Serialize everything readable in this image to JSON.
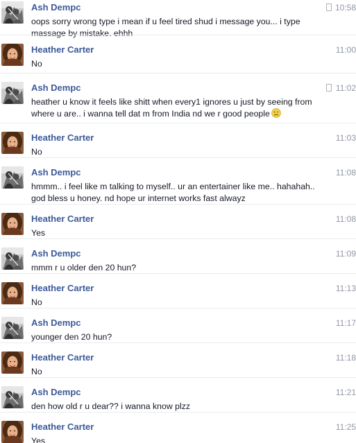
{
  "messages": [
    {
      "sender": "Ash Dempc",
      "time": "10:58",
      "text": "oops sorry wrong type i mean if u feel tired shud i message you... i type massage by mistake. ehhh",
      "mobile": true
    },
    {
      "sender": "Heather Carter",
      "time": "11:00",
      "text": "No",
      "mobile": false
    },
    {
      "sender": "Ash Dempc",
      "time": "11:02",
      "text": "heather u know it feels like shitt when every1 ignores u just by seeing from where u are.. i wanna tell dat m from India nd we r good people",
      "mobile": true,
      "emoji": "frown-emoji"
    },
    {
      "sender": "Heather Carter",
      "time": "11:03",
      "text": "No",
      "mobile": false
    },
    {
      "sender": "Ash Dempc",
      "time": "11:08",
      "text": "hmmm.. i feel like m talking to myself.. ur an entertainer like me.. hahahah.. god bless u honey. nd hope ur internet works fast alwayz",
      "mobile": false
    },
    {
      "sender": "Heather Carter",
      "time": "11:08",
      "text": "Yes",
      "mobile": false
    },
    {
      "sender": "Ash Dempc",
      "time": "11:09",
      "text": "mmm r u older den 20 hun?",
      "mobile": false
    },
    {
      "sender": "Heather Carter",
      "time": "11:13",
      "text": "No",
      "mobile": false
    },
    {
      "sender": "Ash Dempc",
      "time": "11:17",
      "text": "younger den 20 hun?",
      "mobile": false
    },
    {
      "sender": "Heather Carter",
      "time": "11:18",
      "text": "No",
      "mobile": false
    },
    {
      "sender": "Ash Dempc",
      "time": "11:21",
      "text": "den how old r u dear?? i wanna know plzz",
      "mobile": false
    },
    {
      "sender": "Heather Carter",
      "time": "11:25",
      "text": "Yes",
      "mobile": false
    }
  ]
}
